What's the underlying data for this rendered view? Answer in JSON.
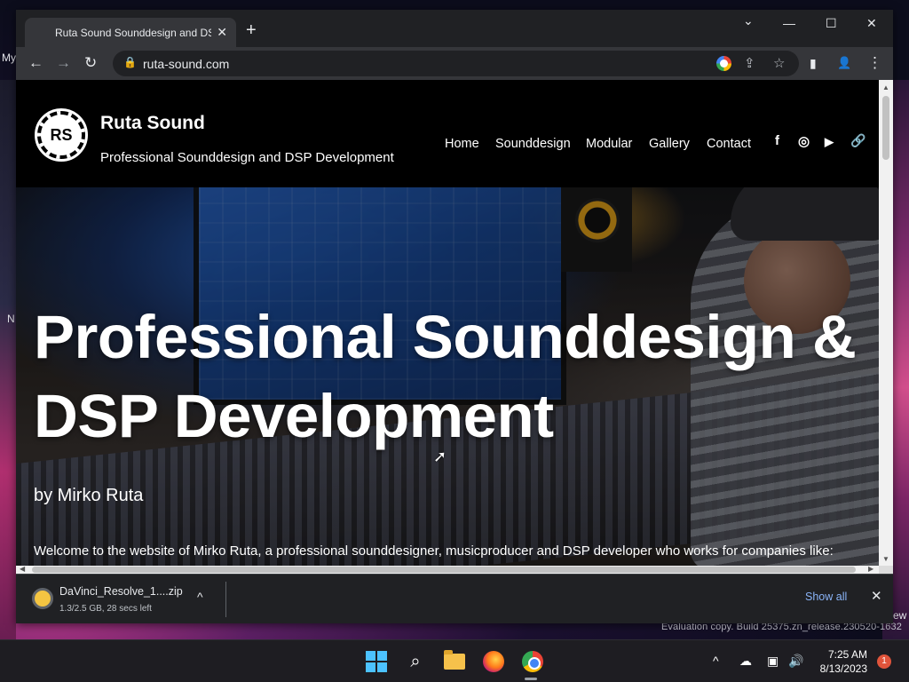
{
  "desktop": {
    "left_label_1": "My",
    "left_label_2": "N",
    "right_label": "ew",
    "evaluation_text": "Evaluation copy. Build 25375.zn_release.230520-1632"
  },
  "browser": {
    "tab": {
      "title": "Ruta Sound Sounddesign and DSP",
      "close": "✕"
    },
    "new_tab": "+",
    "window_controls": {
      "dropdown": "⌄",
      "minimize": "—",
      "maximize": "☐",
      "close": "✕"
    },
    "nav": {
      "back": "←",
      "forward": "→",
      "reload": "↻"
    },
    "omnibox": {
      "url": "ruta-sound.com",
      "lock": "🔒",
      "share": "⇪",
      "bookmark": "☆"
    },
    "toolbar_right": {
      "side_panel": "▮",
      "profile": "👤",
      "menu": "⋮"
    }
  },
  "site": {
    "logo_text": "RS",
    "name": "Ruta Sound",
    "tagline": "Professional Sounddesign and DSP Development",
    "nav": [
      "Home",
      "Sounddesign",
      "Modular",
      "Gallery",
      "Contact"
    ],
    "social": {
      "facebook": "f",
      "instagram": "◎",
      "youtube": "▶",
      "link": "🔗"
    },
    "hero": {
      "heading_line1": "Professional Sounddesign &",
      "heading_line2": "DSP Development",
      "byline": "by Mirko Ruta",
      "welcome": "Welcome to the website of Mirko Ruta, a professional sounddesigner, musicproducer and DSP developer who works for companies like:"
    }
  },
  "download_shelf": {
    "file_name": "DaVinci_Resolve_1....zip",
    "status": "1.3/2.5 GB, 28 secs left",
    "chevron": "^",
    "show_all": "Show all",
    "close": "✕"
  },
  "taskbar": {
    "search": "⌕",
    "tray_chevron": "^",
    "time": "7:25 AM",
    "date": "8/13/2023",
    "notification_count": "1"
  },
  "colors": {
    "accent_link": "#8ab4f8",
    "tab_bg": "#35363a",
    "frame_bg": "#202124"
  }
}
